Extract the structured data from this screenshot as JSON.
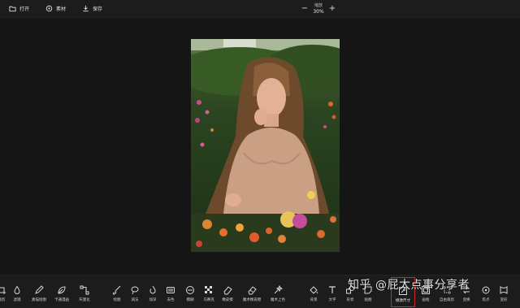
{
  "topbar": {
    "open_label": "打开",
    "assets_label": "素材",
    "save_label": "保存",
    "zoom_label": "缩放",
    "zoom_value": "30%",
    "zoom_out": "−",
    "zoom_in": "+"
  },
  "tools": [
    {
      "label": "裁剪",
      "icon": "crop-icon"
    },
    {
      "label": "滤镜",
      "icon": "drop-icon"
    },
    {
      "label": "素描绘图",
      "icon": "pencil-icon"
    },
    {
      "label": "卡通漫画",
      "icon": "leaf-icon"
    },
    {
      "label": "矢量化",
      "icon": "vector-icon"
    },
    {
      "label": "绘图",
      "icon": "brush-icon"
    },
    {
      "label": "减法",
      "icon": "lasso-icon"
    },
    {
      "label": "加深",
      "icon": "burn-icon"
    },
    {
      "label": "去色",
      "icon": "desaturate-icon"
    },
    {
      "label": "模糊",
      "icon": "keyboard-icon"
    },
    {
      "label": "模糊",
      "icon": "blur-icon"
    },
    {
      "label": "马赛克",
      "icon": "mosaic-icon"
    },
    {
      "label": "橡皮擦",
      "icon": "eraser-icon"
    },
    {
      "label": "魔术橡皮擦",
      "icon": "magic-eraser-icon"
    },
    {
      "label": "魔术上色",
      "icon": "magic-color-icon"
    },
    {
      "label": "背景",
      "icon": "fill-icon"
    },
    {
      "label": "文字",
      "icon": "text-icon"
    },
    {
      "label": "形状",
      "icon": "shape-icon"
    },
    {
      "label": "贴图",
      "icon": "sticker-icon"
    },
    {
      "label": "修改尺寸",
      "icon": "resize-icon",
      "active": true
    },
    {
      "label": "画框",
      "icon": "frame-icon"
    },
    {
      "label": "自由裁剪",
      "icon": "free-crop-icon"
    },
    {
      "label": "变换",
      "icon": "transform-icon"
    },
    {
      "label": "焦点",
      "icon": "focus-icon"
    },
    {
      "label": "变形",
      "icon": "warp-icon"
    }
  ],
  "watermark": "知乎 @屁太点事分享者",
  "colors": {
    "background": "#151515",
    "bar": "#1c1c1c",
    "active_border": "#c62b2b"
  }
}
